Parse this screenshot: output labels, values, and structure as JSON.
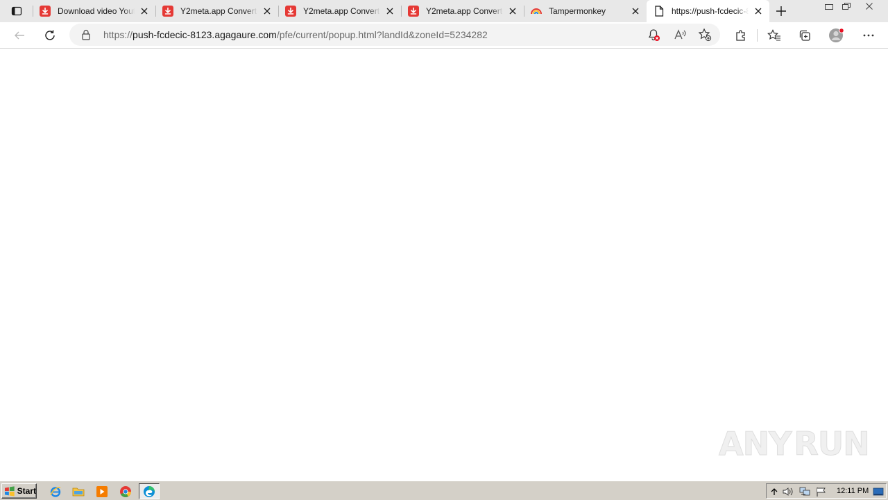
{
  "browser": {
    "tabs": [
      {
        "title": "Download video Youtube",
        "favicon": "y2mate-download-icon",
        "active": false
      },
      {
        "title": "Y2meta.app Converter",
        "favicon": "y2mate-download-icon",
        "active": false
      },
      {
        "title": "Y2meta.app Converter",
        "favicon": "y2mate-download-icon",
        "active": false
      },
      {
        "title": "Y2meta.app Converter",
        "favicon": "y2mate-download-icon",
        "active": false
      },
      {
        "title": "Tampermonkey",
        "favicon": "tampermonkey-icon",
        "active": false
      },
      {
        "title": "https://push-fcdecic-8123.agagaure.com/pfe/current/popup.html?landId&zoneId=5234282",
        "favicon": "page-icon",
        "active": true
      }
    ],
    "address_bar": {
      "url_scheme": "https://",
      "url_host": "push-fcdecic-8123.agagaure.com",
      "url_path": "/pfe/current/popup.html?landId&zoneId=5234282"
    }
  },
  "content": {
    "watermark": {
      "left_text": "ANY",
      "right_text": "RUN"
    }
  },
  "taskbar": {
    "start_label": "Start",
    "quick_launch": [
      "internet-explorer-icon",
      "folder-icon",
      "media-player-icon",
      "chrome-icon",
      "edge-icon"
    ],
    "clock": "12:11 PM"
  },
  "colors": {
    "favicon_red": "#e53935",
    "tabstrip_bg": "#e8e8e8",
    "taskbar_bg": "#d4d0c8",
    "notification_badge": "#e81123"
  }
}
